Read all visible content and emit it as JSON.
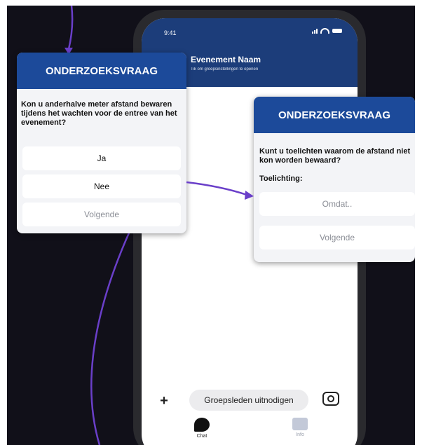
{
  "phone": {
    "status_time": "9:41",
    "group_name": "Evenement Naam",
    "group_subtitle": "Tik om groepsinstellingen te openen",
    "plus_label": "+",
    "invite_label": "Groepsleden uitnodigen",
    "tabs": [
      {
        "label": "Chat"
      },
      {
        "label": "Info"
      }
    ]
  },
  "card_left": {
    "header": "ONDERZOEKSVRAAG",
    "question": "Kon u anderhalve meter afstand bewaren tijdens het wachten voor de entree van het evenement?",
    "options": [
      "Ja",
      "Nee"
    ],
    "next_label": "Volgende"
  },
  "card_right": {
    "header": "ONDERZOEKSVRAAG",
    "question": "Kunt u toelichten waarom de afstand niet kon worden bewaard?",
    "field_label": "Toelichting:",
    "input_placeholder": "Omdat..",
    "next_label": "Volgende"
  },
  "colors": {
    "background": "#111019",
    "header_blue": "#1c4a9a",
    "phone_header": "#1c3d7a",
    "flow_line": "#6a3fc9"
  },
  "icons": [
    "signal-icon",
    "wifi-icon",
    "battery-icon",
    "camera-icon",
    "chat-icon",
    "info-icon"
  ]
}
